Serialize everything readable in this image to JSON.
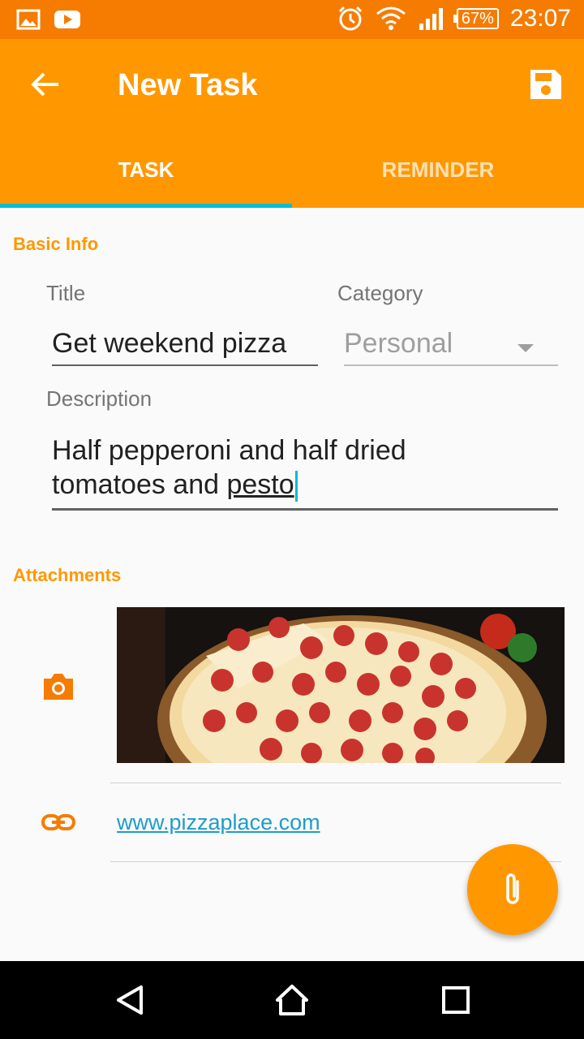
{
  "status_bar": {
    "battery": "67%",
    "time": "23:07",
    "icons": [
      "gallery-icon",
      "youtube-icon",
      "alarm-icon",
      "wifi-icon",
      "signal-icon",
      "battery-icon"
    ]
  },
  "app_bar": {
    "title": "New Task",
    "back_icon": "arrow-back-icon",
    "save_icon": "save-icon",
    "tabs": [
      {
        "label": "TASK",
        "active": true
      },
      {
        "label": "REMINDER",
        "active": false
      }
    ]
  },
  "basic_info": {
    "header": "Basic Info",
    "title_label": "Title",
    "title_value": "Get weekend pizza",
    "category_label": "Category",
    "category_value": "Personal",
    "description_label": "Description",
    "description_line1": "Half pepperoni and half dried",
    "description_line2_prefix": "tomatoes and ",
    "description_line2_word": "pesto"
  },
  "attachments": {
    "header": "Attachments",
    "photo_icon": "camera-icon",
    "link_icon": "link-icon",
    "link": "www.pizzaplace.com"
  },
  "fab": {
    "icon": "attachment-icon"
  },
  "nav_bar": {
    "icons": [
      "back-triangle-icon",
      "home-icon",
      "recents-icon"
    ]
  },
  "colors": {
    "primary": "#ff9800",
    "primary_dark": "#f57c00",
    "accent": "#00bcd4",
    "link": "#1e9dc8"
  }
}
